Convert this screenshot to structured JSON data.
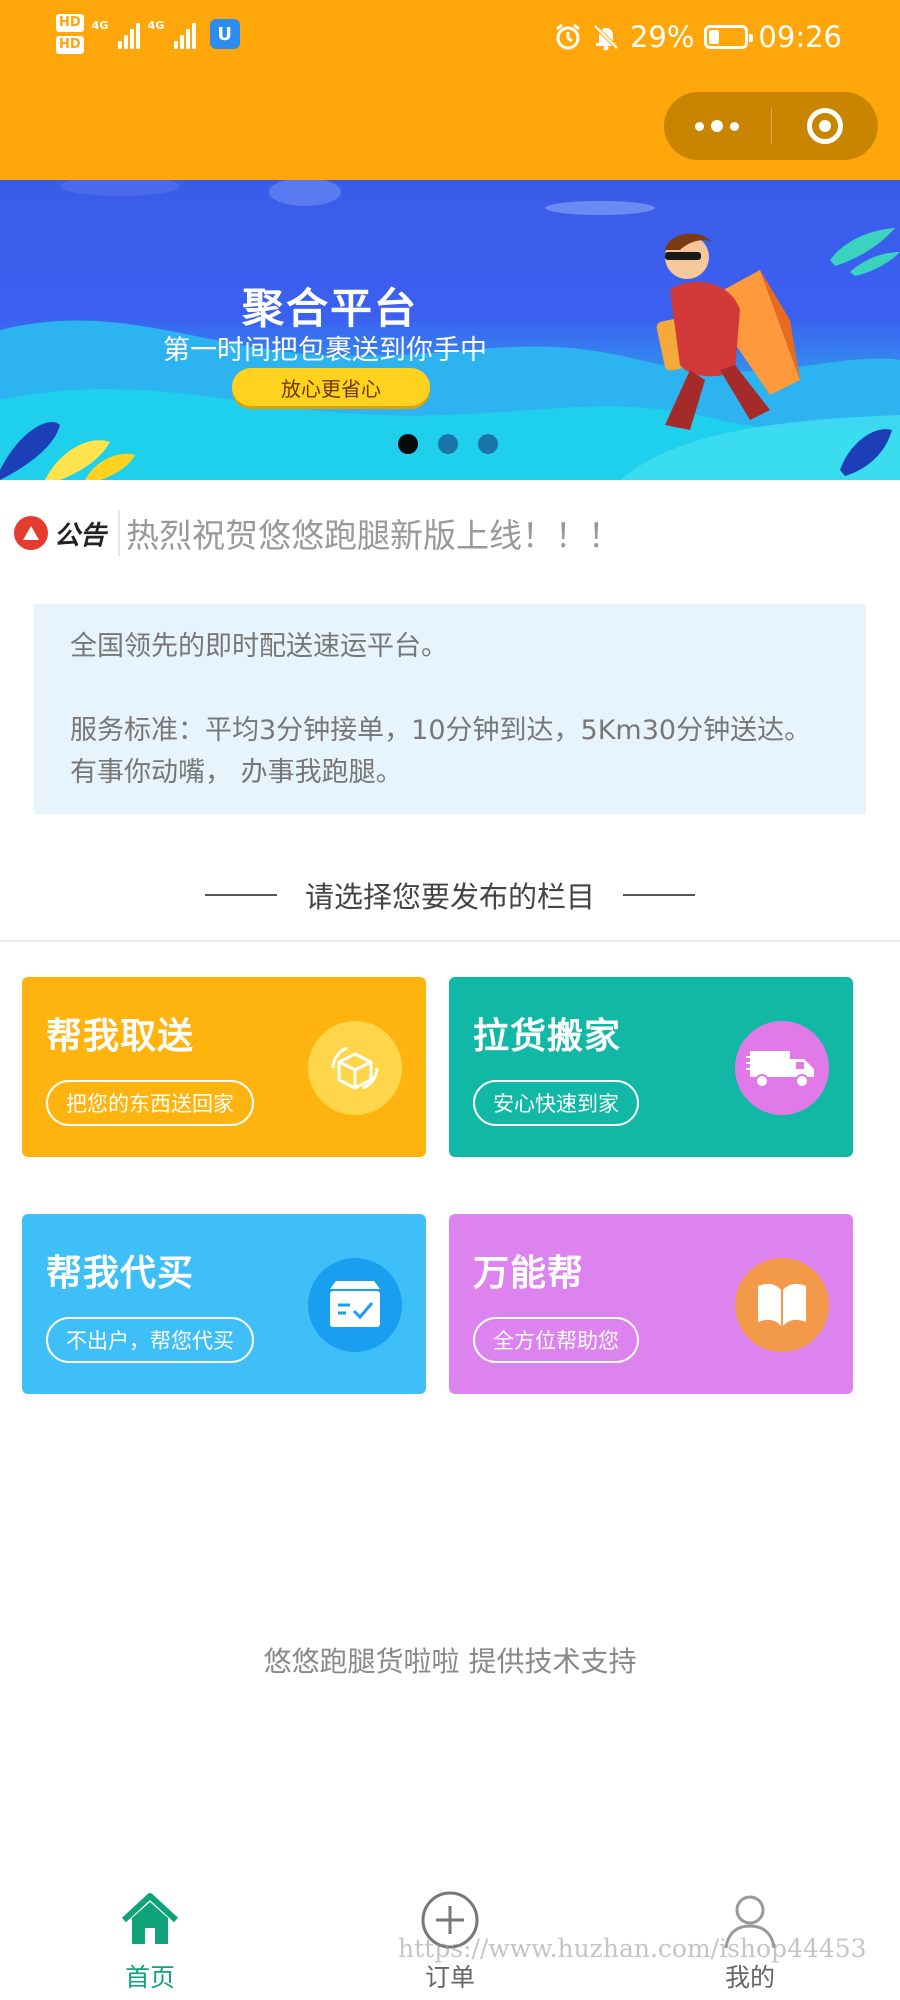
{
  "status_bar": {
    "hd_labels": [
      "HD",
      "HD"
    ],
    "network_labels": [
      "4G",
      "4G"
    ],
    "app_badge": "U",
    "battery_text": "29%",
    "battery_level": 0.29,
    "time": "09:26",
    "icons": [
      "alarm-icon",
      "mute-bell-icon",
      "battery-icon"
    ]
  },
  "capsule": {
    "more_icon": "more-dots-icon",
    "close_icon": "target-close-icon"
  },
  "banner": {
    "title": "聚合平台",
    "subtitle": "第一时间把包裹送到你手中",
    "button": "放心更省心",
    "active_page": 1,
    "page_count": 3
  },
  "notice": {
    "label": "公告",
    "text": "热烈祝贺悠悠跑腿新版上线！！！"
  },
  "intro": {
    "line1": "全国领先的即时配送速运平台。",
    "line2": "服务标准：平均3分钟接单，10分钟到达，5Km30分钟送达。有事你动嘴，  办事我跑腿。"
  },
  "section_title": "请选择您要发布的栏目",
  "categories": [
    {
      "title": "帮我取送",
      "tag": "把您的东西送回家",
      "icon": "box-delivery-icon",
      "color": "#ffb30f"
    },
    {
      "title": "拉货搬家",
      "tag": "安心快速到家",
      "icon": "truck-icon",
      "color": "#11b8a6"
    },
    {
      "title": "帮我代买",
      "tag": "不出户，帮您代买",
      "icon": "shopping-box-check-icon",
      "color": "#3fbff8"
    },
    {
      "title": "万能帮",
      "tag": "全方位帮助您",
      "icon": "book-icon",
      "color": "#dc83ef"
    }
  ],
  "support_text": "悠悠跑腿货啦啦 提供技术支持",
  "tabbar": {
    "items": [
      {
        "label": "首页",
        "icon": "home-icon",
        "active": true
      },
      {
        "label": "订单",
        "icon": "plus-circle-icon",
        "active": false
      },
      {
        "label": "我的",
        "icon": "user-icon",
        "active": false
      }
    ]
  },
  "watermark": "https://www.huzhan.com/ishop44453",
  "colors": {
    "header": "#ffa60a",
    "accent_green": "#10a37a"
  }
}
